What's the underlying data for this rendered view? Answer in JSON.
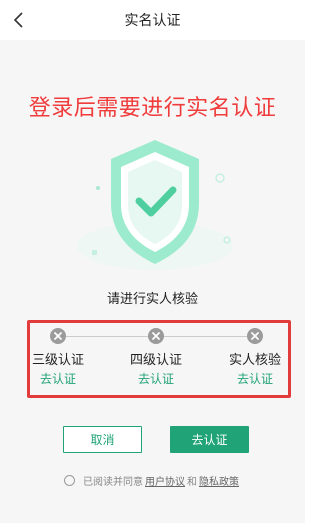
{
  "nav": {
    "title": "实名认证",
    "back_icon": "chevron-left-icon"
  },
  "headline": "登录后需要进行实名认证",
  "subtitle": "请进行实人核验",
  "steps": [
    {
      "label": "三级认证",
      "action": "去认证",
      "status_icon": "close-circle-icon"
    },
    {
      "label": "四级认证",
      "action": "去认证",
      "status_icon": "close-circle-icon"
    },
    {
      "label": "实人核验",
      "action": "去认证",
      "status_icon": "close-circle-icon"
    }
  ],
  "buttons": {
    "cancel": "取消",
    "confirm": "去认证"
  },
  "agreement": {
    "prefix": "已阅读并同意",
    "user_agreement": "用户协议",
    "and": "和",
    "privacy_policy": "隐私政策",
    "checked": false
  },
  "colors": {
    "accent": "#21a378",
    "headline": "#f03c3c",
    "highlight_border": "#e23b3b",
    "shield": "#7fe3bf"
  }
}
